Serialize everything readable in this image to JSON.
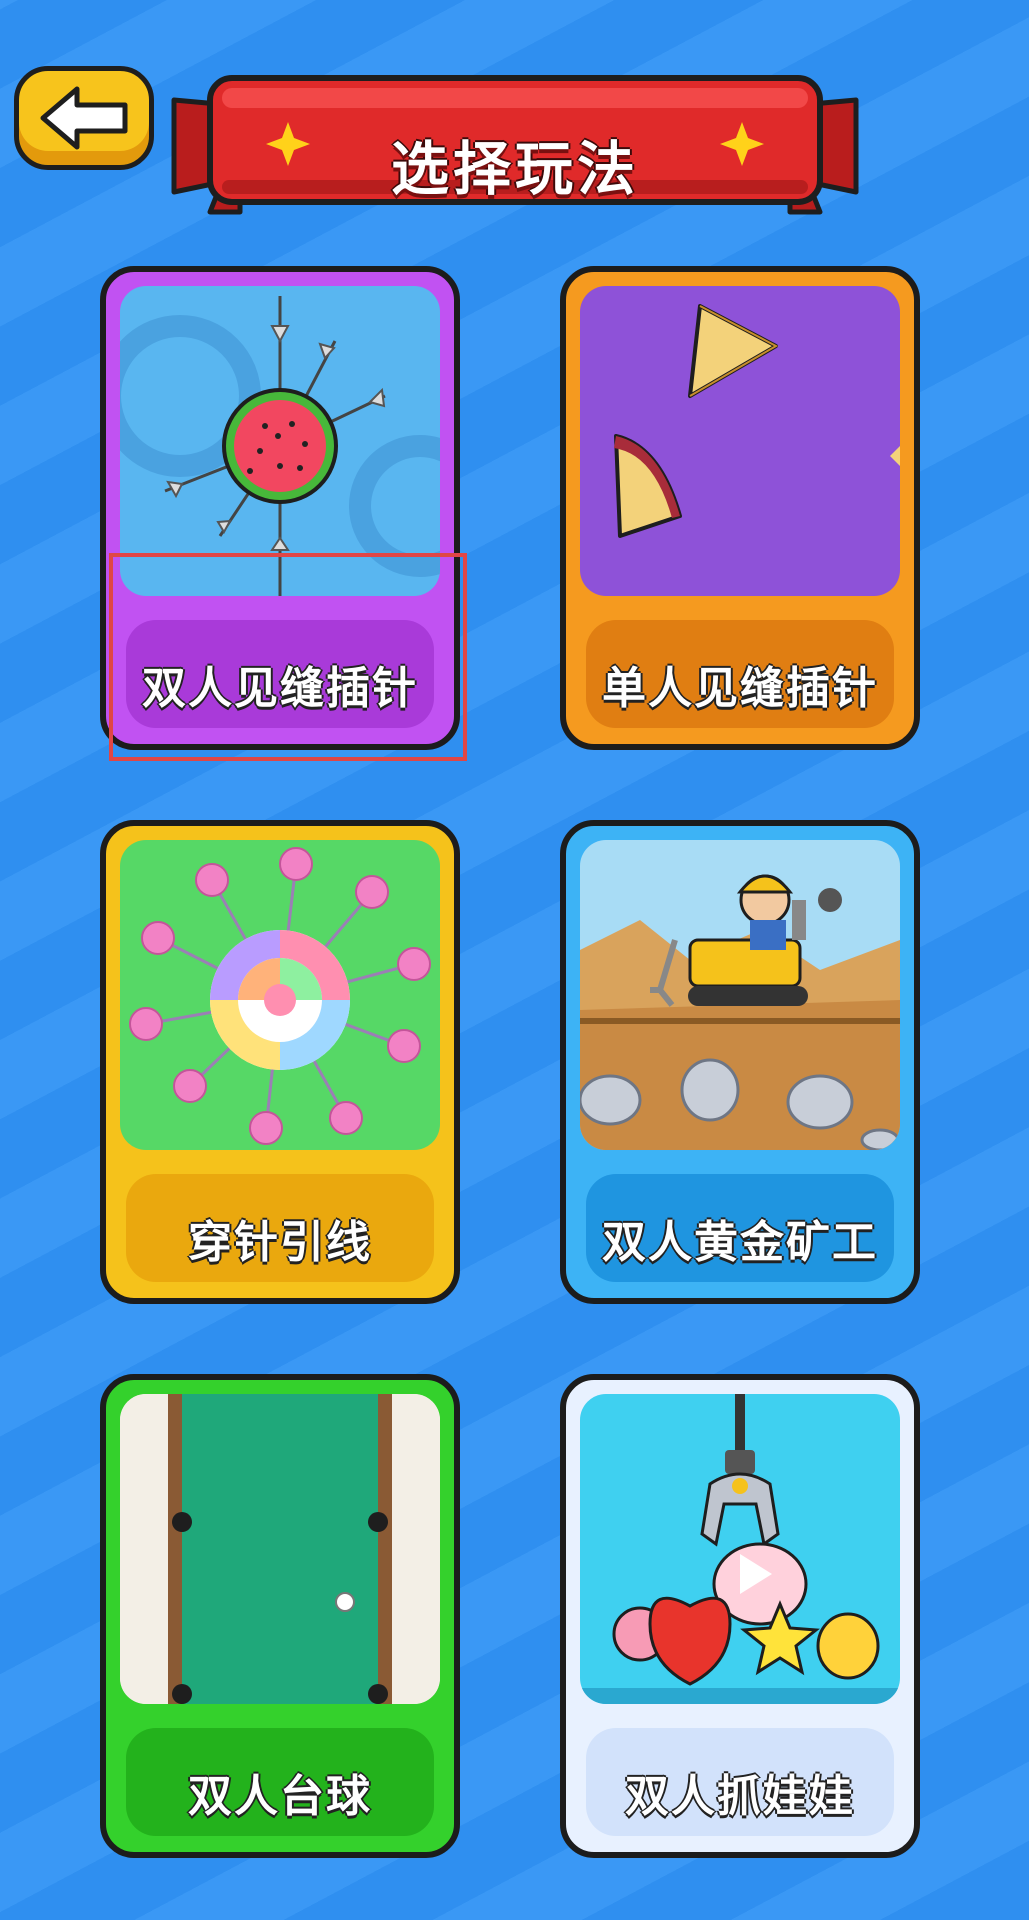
{
  "header": {
    "title": "选择玩法",
    "back_icon": "left-arrow-icon"
  },
  "colors": {
    "background": "#2f8ff0",
    "banner_red": "#e02a2a",
    "back_button": "#f7c41c",
    "highlight": "#e04646"
  },
  "games": [
    {
      "label": "双人见缝插针",
      "theme": "#c152f2",
      "plate": "#a93ad9",
      "art": "watermelon-arrows-icon"
    },
    {
      "label": "单人见缝插针",
      "theme": "#f59a1f",
      "plate": "#e07e12",
      "art": "cake-slices-icon"
    },
    {
      "label": "穿针引线",
      "theme": "#f5c21b",
      "plate": "#eaa80e",
      "art": "candy-swirl-pins-icon"
    },
    {
      "label": "双人黄金矿工",
      "theme": "#3db3f5",
      "plate": "#1f95e0",
      "art": "gold-miner-icon"
    },
    {
      "label": "双人台球",
      "theme": "#34d12c",
      "plate": "#23b21c",
      "art": "billiard-table-icon"
    },
    {
      "label": "双人抓娃娃",
      "theme": "#e8f1ff",
      "plate": "#d2e2fb",
      "art": "claw-machine-icon"
    }
  ]
}
